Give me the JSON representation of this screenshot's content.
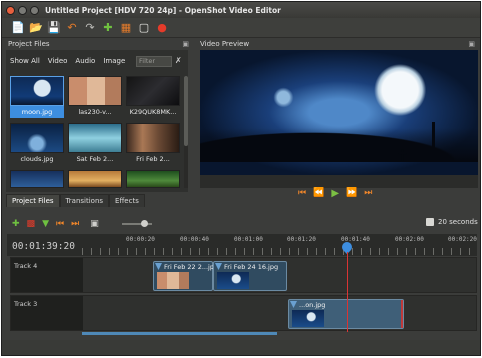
{
  "window": {
    "title": "Untitled Project [HDV 720 24p] - OpenShot Video Editor"
  },
  "toolbar": {
    "icons": [
      "new-project-icon",
      "open-project-icon",
      "save-project-icon",
      "undo-icon",
      "redo-icon",
      "import-files-icon",
      "choose-profile-icon",
      "fullscreen-icon",
      "export-video-icon"
    ]
  },
  "project_files": {
    "header": "Project Files",
    "tabs": [
      "Show All",
      "Video",
      "Audio",
      "Image"
    ],
    "filter_placeholder": "Filter",
    "items": [
      {
        "label": "moon.jpg",
        "selected": true
      },
      {
        "label": "las230-v...",
        "selected": false
      },
      {
        "label": "K29QUK8MK...",
        "selected": false
      },
      {
        "label": "clouds.jpg",
        "selected": false
      },
      {
        "label": "Sat Feb 2...",
        "selected": false
      },
      {
        "label": "Fri Feb 2...",
        "selected": false
      }
    ],
    "bottom_tabs": [
      "Project Files",
      "Transitions",
      "Effects"
    ]
  },
  "video_preview": {
    "header": "Video Preview"
  },
  "timeline": {
    "zoom_label": "20 seconds",
    "timecode": "00:01:39:20",
    "ticks": [
      "00:00:20",
      "00:00:40",
      "00:01:00",
      "00:01:20",
      "00:01:40",
      "00:02:00",
      "00:02:20"
    ],
    "tracks": [
      {
        "name": "Track 4",
        "clips": [
          "Fri Feb 22 2...jpg",
          "Fri Feb 24 16.jpg"
        ]
      },
      {
        "name": "Track 3",
        "clips": [
          "...on.jpg"
        ]
      }
    ]
  }
}
